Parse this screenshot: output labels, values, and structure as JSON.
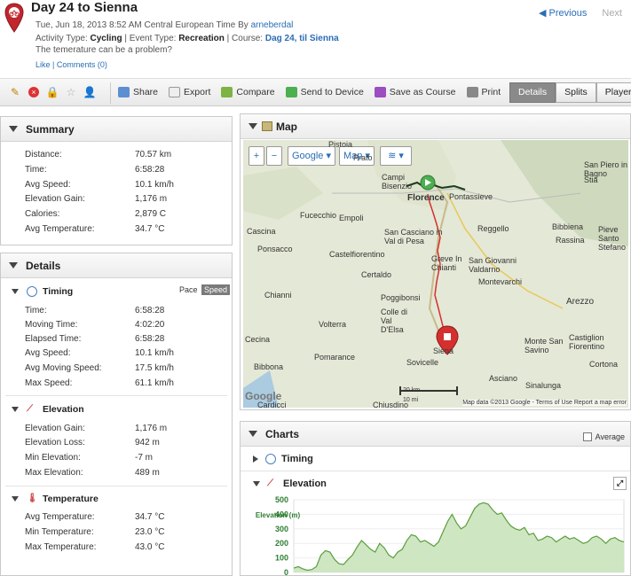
{
  "header": {
    "title": "Day 24 to Sienna",
    "date_prefix": "Tue, Jun 18, 2013 8:52 AM Central European Time By ",
    "author": "arneberdal",
    "activity_type_label": "Activity Type: ",
    "activity_type": "Cycling",
    "event_type_label": " | Event Type: ",
    "event_type": "Recreation",
    "course_label": " | Course: ",
    "course": "Dag 24, til Sienna",
    "description": "The temerature can be a problem?",
    "like": "Like",
    "comments": "Comments (0)",
    "prev": "Previous",
    "next": "Next"
  },
  "toolbar": {
    "share": "Share",
    "export": "Export",
    "compare": "Compare",
    "send": "Send to Device",
    "save_course": "Save as Course",
    "print": "Print",
    "tabs": [
      "Details",
      "Splits",
      "Player"
    ]
  },
  "summary": {
    "title": "Summary",
    "rows": [
      {
        "label": "Distance:",
        "value": "70.57 km"
      },
      {
        "label": "Time:",
        "value": "6:58:28"
      },
      {
        "label": "Avg Speed:",
        "value": "10.1 km/h"
      },
      {
        "label": "Elevation Gain:",
        "value": "1,176 m"
      },
      {
        "label": "Calories:",
        "value": "2,879 C"
      },
      {
        "label": "Avg Temperature:",
        "value": "34.7 °C"
      }
    ]
  },
  "details": {
    "title": "Details",
    "timing": {
      "title": "Timing",
      "pace": "Pace",
      "speed": "Speed",
      "rows": [
        {
          "label": "Time:",
          "value": "6:58:28"
        },
        {
          "label": "Moving Time:",
          "value": "4:02:20"
        },
        {
          "label": "Elapsed Time:",
          "value": "6:58:28"
        },
        {
          "label": "Avg Speed:",
          "value": "10.1 km/h"
        },
        {
          "label": "Avg Moving Speed:",
          "value": "17.5 km/h"
        },
        {
          "label": "Max Speed:",
          "value": "61.1 km/h"
        }
      ]
    },
    "elevation": {
      "title": "Elevation",
      "rows": [
        {
          "label": "Elevation Gain:",
          "value": "1,176 m"
        },
        {
          "label": "Elevation Loss:",
          "value": "942 m"
        },
        {
          "label": "Min Elevation:",
          "value": "-7 m"
        },
        {
          "label": "Max Elevation:",
          "value": "489 m"
        }
      ]
    },
    "temperature": {
      "title": "Temperature",
      "rows": [
        {
          "label": "Avg Temperature:",
          "value": "34.7 °C"
        },
        {
          "label": "Min Temperature:",
          "value": "23.0 °C"
        },
        {
          "label": "Max Temperature:",
          "value": "43.0 °C"
        }
      ]
    }
  },
  "map": {
    "title": "Map",
    "zoom_in": "+",
    "zoom_out": "−",
    "provider": "Google",
    "type": "Map",
    "places": [
      "Pistoia",
      "Prato",
      "Campi Bisenzio",
      "Florence",
      "Pontassieve",
      "Fucecchio",
      "Empoli",
      "San Casciano in Val di Pesa",
      "Reggello",
      "Cascina",
      "Castelfiorentino",
      "Greve In Chianti",
      "San Giovanni Valdarno",
      "Ponsacco",
      "Certaldo",
      "Montevarchi",
      "Chianni",
      "Poggibonsi",
      "Colle di Val D'Elsa",
      "Arezzo",
      "Volterra",
      "Siena",
      "Monte San Savino",
      "Castiglion Fiorentino",
      "Pomarance",
      "Sovicelle",
      "Bibbona",
      "Asciano",
      "Sinalunga",
      "Cortona",
      "Bibbiena",
      "Rassina",
      "Stia",
      "San Piero in Bagno",
      "Pieve Santo Stefano",
      "Chiusdino",
      "Cecina",
      "Cardicci"
    ],
    "scale_km": "20 km",
    "scale_mi": "10 mi",
    "attribution": "Map data ©2013 Google - Terms of Use",
    "report": "Report a map error",
    "logo": "Google"
  },
  "charts": {
    "title": "Charts",
    "average": "Average",
    "timing": "Timing",
    "elevation": "Elevation",
    "ylabel": "Elevation (m)",
    "chart_data": {
      "type": "area",
      "ylabel": "Elevation (m)",
      "ylim": [
        0,
        500
      ],
      "yticks": [
        "500",
        "400",
        "300",
        "200",
        "100",
        "0"
      ],
      "values": [
        30,
        40,
        25,
        15,
        20,
        40,
        120,
        150,
        140,
        90,
        60,
        55,
        90,
        120,
        175,
        220,
        190,
        160,
        140,
        200,
        170,
        120,
        100,
        140,
        160,
        220,
        260,
        250,
        210,
        220,
        200,
        180,
        210,
        280,
        350,
        400,
        340,
        300,
        320,
        380,
        440,
        470,
        480,
        470,
        430,
        400,
        410,
        360,
        320,
        300,
        290,
        310,
        260,
        270,
        220,
        230,
        250,
        240,
        210,
        230,
        250,
        230,
        240,
        220,
        200,
        210,
        240,
        250,
        230,
        200,
        230,
        240,
        220,
        210
      ]
    }
  }
}
